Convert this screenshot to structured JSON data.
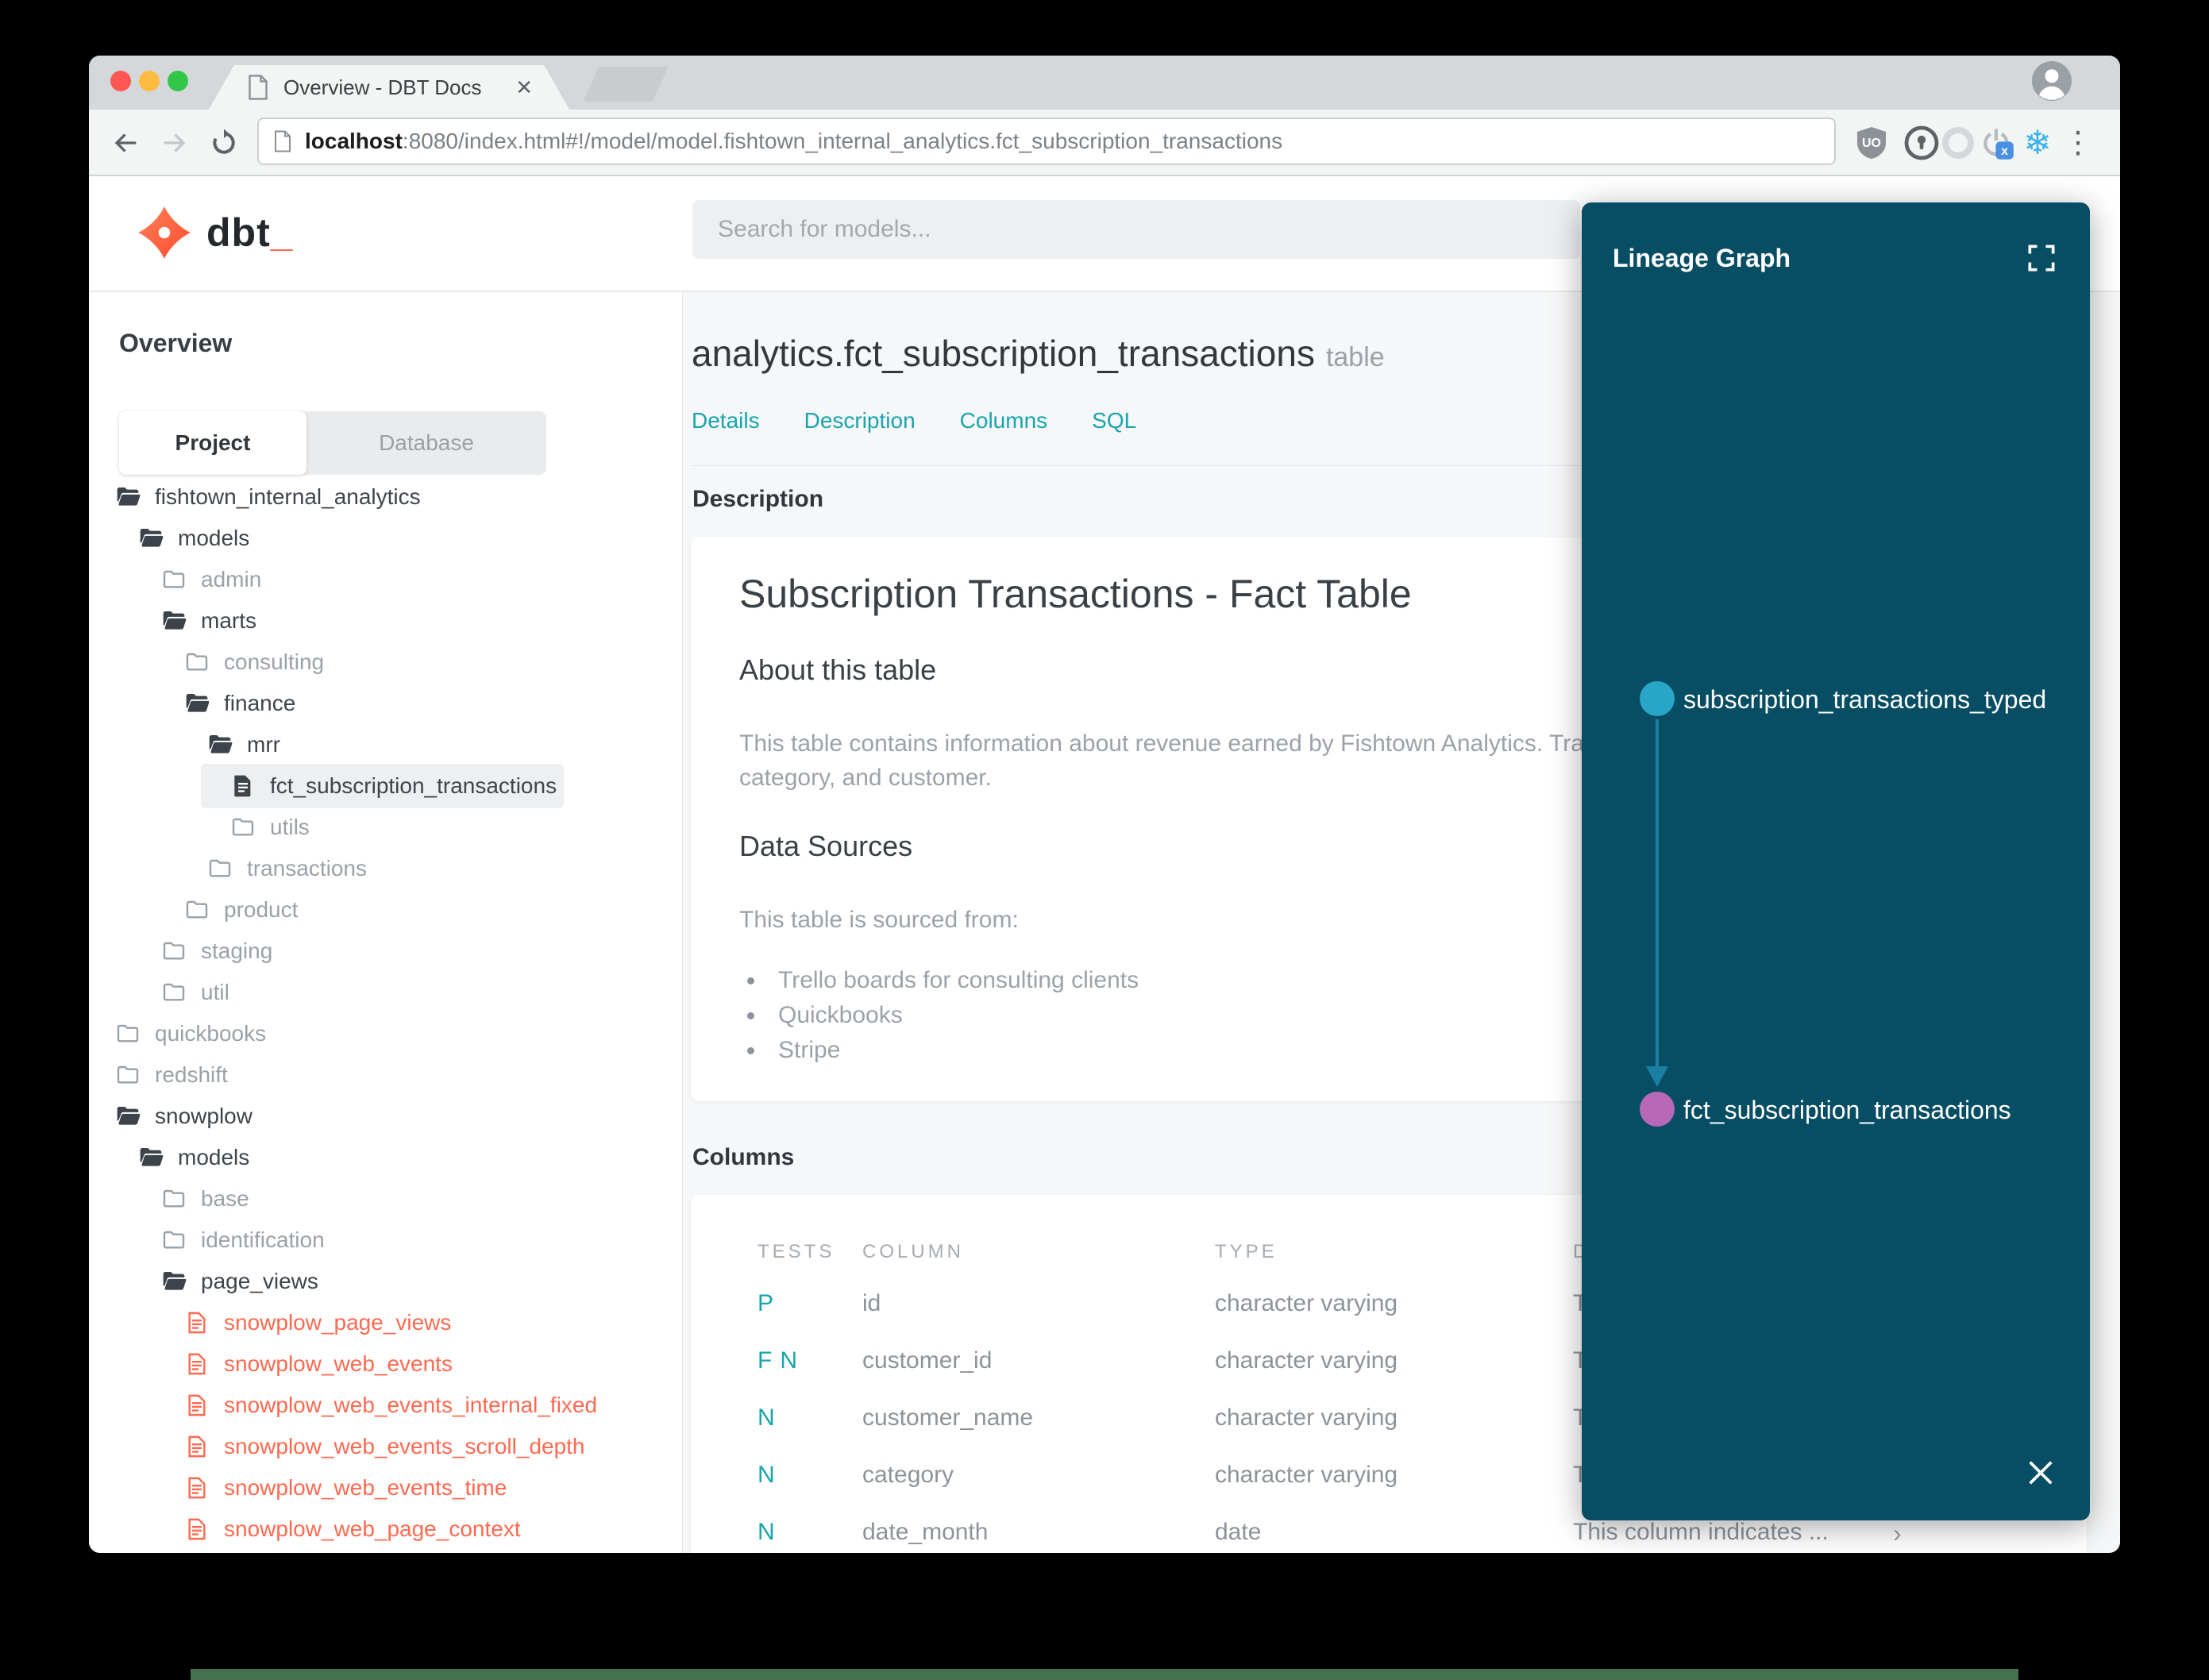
{
  "browser": {
    "tab_title": "Overview - DBT Docs",
    "close_tab": "✕",
    "url_host": "localhost",
    "url_rest": ":8080/index.html#!/model/model.fishtown_internal_analytics.fct_subscription_transactions",
    "menu_dots": "⋮",
    "snowflake": "❄"
  },
  "header": {
    "logo_text": "dbt",
    "logo_underscore": "_",
    "search_placeholder": "Search for models..."
  },
  "sidebar": {
    "heading": "Overview",
    "toggle": {
      "project": "Project",
      "database": "Database"
    },
    "tree": [
      {
        "label": "fishtown_internal_analytics",
        "level": 0,
        "type": "folder-open",
        "tone": "dark"
      },
      {
        "label": "models",
        "level": 1,
        "type": "folder-open",
        "tone": "dark"
      },
      {
        "label": "admin",
        "level": 2,
        "type": "folder-closed",
        "tone": "grey"
      },
      {
        "label": "marts",
        "level": 2,
        "type": "folder-open",
        "tone": "dark"
      },
      {
        "label": "consulting",
        "level": 3,
        "type": "folder-closed",
        "tone": "grey"
      },
      {
        "label": "finance",
        "level": 3,
        "type": "folder-open",
        "tone": "dark"
      },
      {
        "label": "mrr",
        "level": 4,
        "type": "folder-open",
        "tone": "dark"
      },
      {
        "label": "fct_subscription_transactions",
        "level": 5,
        "type": "model",
        "tone": "dark",
        "selected": true
      },
      {
        "label": "utils",
        "level": 5,
        "type": "folder-closed",
        "tone": "grey"
      },
      {
        "label": "transactions",
        "level": 4,
        "type": "folder-closed",
        "tone": "grey"
      },
      {
        "label": "product",
        "level": 3,
        "type": "folder-closed",
        "tone": "grey"
      },
      {
        "label": "staging",
        "level": 2,
        "type": "folder-closed",
        "tone": "grey"
      },
      {
        "label": "util",
        "level": 2,
        "type": "folder-closed",
        "tone": "grey"
      },
      {
        "label": "quickbooks",
        "level": 0,
        "type": "folder-closed",
        "tone": "grey"
      },
      {
        "label": "redshift",
        "level": 0,
        "type": "folder-closed",
        "tone": "grey"
      },
      {
        "label": "snowplow",
        "level": 0,
        "type": "folder-open",
        "tone": "dark"
      },
      {
        "label": "models",
        "level": 1,
        "type": "folder-open",
        "tone": "dark"
      },
      {
        "label": "base",
        "level": 2,
        "type": "folder-closed",
        "tone": "grey"
      },
      {
        "label": "identification",
        "level": 2,
        "type": "folder-closed",
        "tone": "grey"
      },
      {
        "label": "page_views",
        "level": 2,
        "type": "folder-open",
        "tone": "dark"
      },
      {
        "label": "snowplow_page_views",
        "level": 3,
        "type": "model-error",
        "tone": "red"
      },
      {
        "label": "snowplow_web_events",
        "level": 3,
        "type": "model-error",
        "tone": "red"
      },
      {
        "label": "snowplow_web_events_internal_fixed",
        "level": 3,
        "type": "model-error",
        "tone": "red"
      },
      {
        "label": "snowplow_web_events_scroll_depth",
        "level": 3,
        "type": "model-error",
        "tone": "red"
      },
      {
        "label": "snowplow_web_events_time",
        "level": 3,
        "type": "model-error",
        "tone": "red"
      },
      {
        "label": "snowplow_web_page_context",
        "level": 3,
        "type": "model-error",
        "tone": "red"
      }
    ]
  },
  "main": {
    "title": "analytics.fct_subscription_transactions",
    "title_suffix": "table",
    "nav_tabs": [
      "Details",
      "Description",
      "Columns",
      "SQL"
    ],
    "description_section": {
      "label": "Description",
      "card_title": "Subscription Transactions - Fact Table",
      "about_heading": "About this table",
      "about_lines": [
        "This table contains information about revenue earned by Fishtown Analytics. Trans",
        "category, and customer."
      ],
      "sources_heading": "Data Sources",
      "sources_intro": "This table is sourced from:",
      "sources": [
        "Trello boards for consulting clients",
        "Quickbooks",
        "Stripe"
      ]
    },
    "columns_section": {
      "label": "Columns",
      "headers": {
        "tests": "TESTS",
        "column": "COLUMN",
        "type": "TYPE",
        "description": "D"
      },
      "rows": [
        {
          "tests": [
            "P"
          ],
          "column": "id",
          "type": "character varying",
          "description": "T",
          "chevron": ""
        },
        {
          "tests": [
            "F",
            "N"
          ],
          "column": "customer_id",
          "type": "character varying",
          "description": "T",
          "chevron": ""
        },
        {
          "tests": [
            "N"
          ],
          "column": "customer_name",
          "type": "character varying",
          "description": "T",
          "chevron": ""
        },
        {
          "tests": [
            "N"
          ],
          "column": "category",
          "type": "character varying",
          "description": "T",
          "chevron": ""
        },
        {
          "tests": [
            "N"
          ],
          "column": "date_month",
          "type": "date",
          "description": "This column indicates ...",
          "chevron": "›"
        }
      ]
    }
  },
  "lineage": {
    "title": "Lineage Graph",
    "nodes": [
      {
        "label": "subscription_transactions_typed",
        "color": "#29a5c7"
      },
      {
        "label": "fct_subscription_transactions",
        "color": "#b768b8"
      }
    ]
  },
  "colors": {
    "accent_teal": "#18a5ae",
    "model_error_red": "#ff6950",
    "lineage_bg": "#074d63",
    "node_top": "#29a5c7",
    "node_bottom": "#b768b8",
    "arrow": "#1b7fa3",
    "wallpaper_green": "#477050"
  }
}
